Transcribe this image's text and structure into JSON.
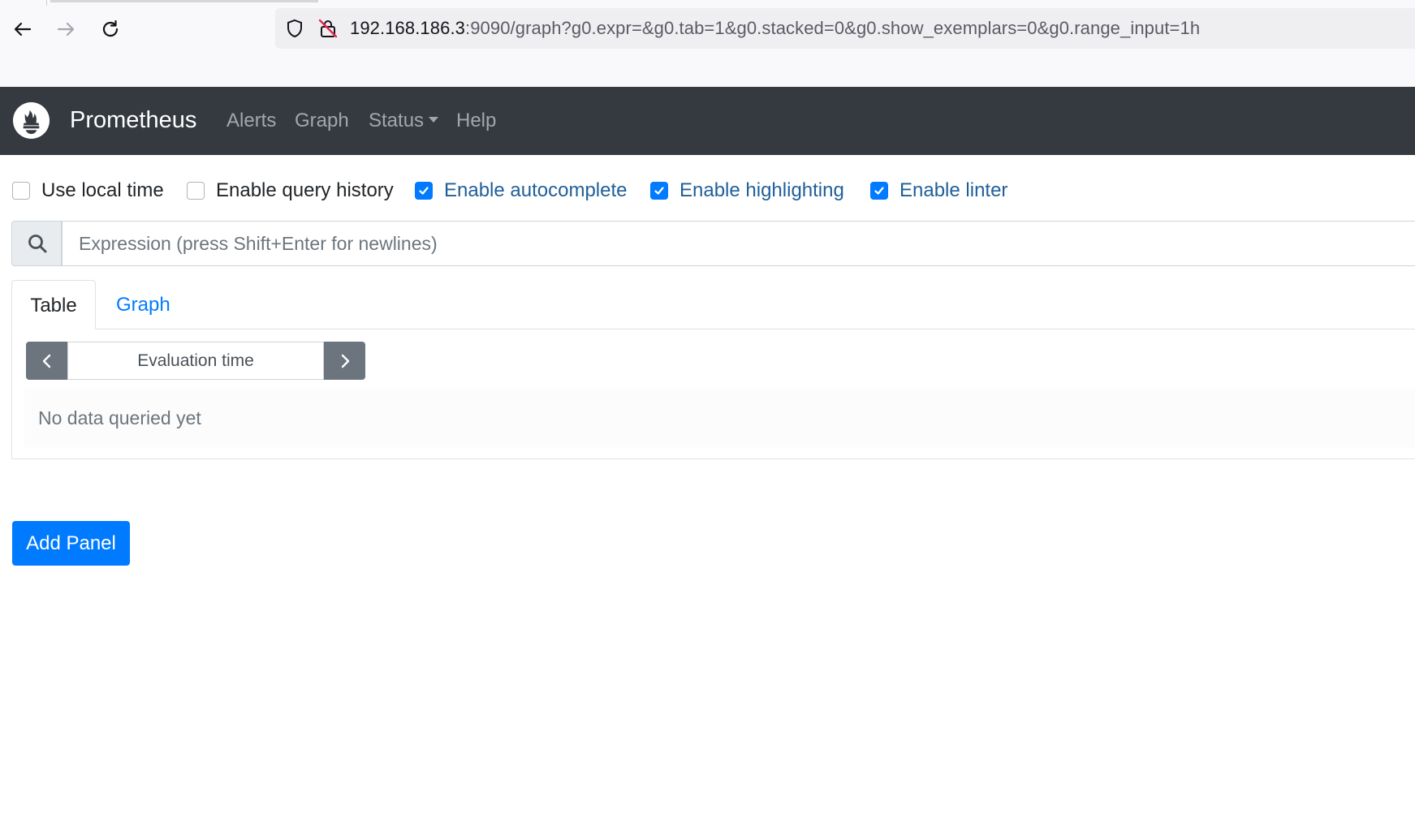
{
  "browser": {
    "url_host": "192.168.186.3",
    "url_rest": ":9090/graph?g0.expr=&g0.tab=1&g0.stacked=0&g0.show_exemplars=0&g0.range_input=1h"
  },
  "navbar": {
    "brand": "Prometheus",
    "links": [
      "Alerts",
      "Graph",
      "Status",
      "Help"
    ]
  },
  "options": [
    {
      "label": "Use local time",
      "checked": false
    },
    {
      "label": "Enable query history",
      "checked": false
    },
    {
      "label": "Enable autocomplete",
      "checked": true
    },
    {
      "label": "Enable highlighting",
      "checked": true
    },
    {
      "label": "Enable linter",
      "checked": true
    }
  ],
  "expression": {
    "placeholder": "Expression (press Shift+Enter for newlines)"
  },
  "panel": {
    "tabs": [
      "Table",
      "Graph"
    ],
    "active_tab": "Table",
    "evaluation_placeholder": "Evaluation time",
    "empty_message": "No data queried yet"
  },
  "add_panel_label": "Add Panel",
  "colors": {
    "navbar": "#343a40",
    "accent": "#007bff",
    "secondary": "#6c757d"
  }
}
